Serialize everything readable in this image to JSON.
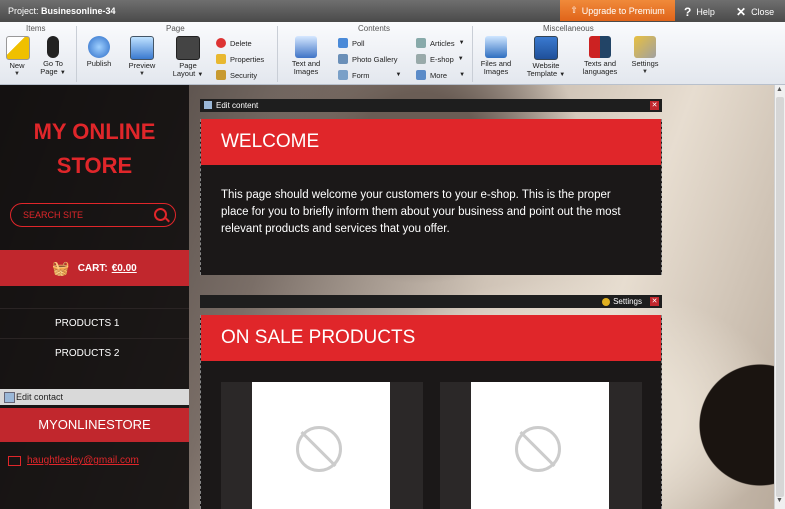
{
  "titlebar": {
    "project_label": "Project:",
    "project_name": "Businesonline-34",
    "upgrade_label": "Upgrade to Premium",
    "help_label": "Help",
    "close_label": "Close"
  },
  "ribbon": {
    "groups": {
      "items": "Items",
      "page": "Page",
      "contents": "Contents",
      "misc": "Miscellaneous"
    },
    "new": "New",
    "goto_page": [
      "Go To",
      "Page"
    ],
    "publish": "Publish",
    "preview": "Preview",
    "page_layout": [
      "Page",
      "Layout"
    ],
    "delete": "Delete",
    "properties": "Properties",
    "security": "Security",
    "text_images": [
      "Text and",
      "Images"
    ],
    "poll": "Poll",
    "photo_gallery": "Photo Gallery",
    "form": "Form",
    "articles": "Articles",
    "eshop": "E-shop",
    "more": "More",
    "files_images": [
      "Files and",
      "Images"
    ],
    "website_template": [
      "Website",
      "Template"
    ],
    "texts_languages": [
      "Texts and",
      "languages"
    ],
    "settings": "Settings"
  },
  "sidebar": {
    "logo_line1": "MY ONLINE",
    "logo_line2": "STORE",
    "search_placeholder": "SEARCH SITE",
    "cart_label": "CART:",
    "cart_value": "€0.00",
    "nav": [
      "PRODUCTS 1",
      "PRODUCTS 2"
    ],
    "edit_contact": "Edit contact",
    "contact_title": "MYONLINESTORE",
    "email": "haughtlesley@gmail.com"
  },
  "content": {
    "edit_content": "Edit content",
    "welcome_title": "WELCOME",
    "welcome_text": "This page should welcome your customers to your e-shop. This is the proper place for you to briefly inform them about your business and point out the most relevant products and services that you offer.",
    "settings_label": "Settings",
    "sale_title": "ON SALE PRODUCTS"
  },
  "colors": {
    "accent_red": "#e0262a",
    "upgrade_orange": "#e8731f",
    "sidebar_dark": "#0f0c0c"
  }
}
